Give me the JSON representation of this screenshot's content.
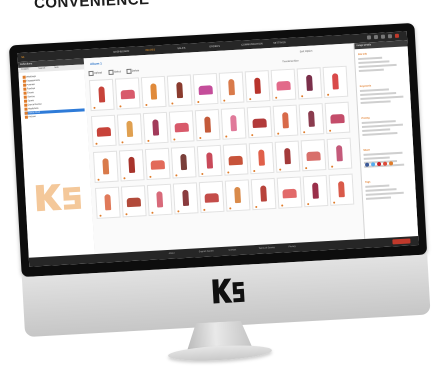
{
  "headline": "CONVENIENCE",
  "app": {
    "brand_initials": "ks",
    "top_nav": [
      {
        "label": "DASHBOARD",
        "active": false
      },
      {
        "label": "IMAGES",
        "active": true
      },
      {
        "label": "SALES",
        "active": false
      },
      {
        "label": "ORDERS",
        "active": false
      },
      {
        "label": "COMMUNICATION",
        "active": false
      },
      {
        "label": "SETTINGS",
        "active": false
      }
    ],
    "sidebar": {
      "title": "Collections",
      "tabs": [
        "Folders",
        "Search",
        "Sets"
      ],
      "items": [
        {
          "label": "Weddings",
          "selected": false
        },
        {
          "label": "Engagements",
          "selected": false
        },
        {
          "label": "Portraits",
          "selected": false
        },
        {
          "label": "Families",
          "selected": false
        },
        {
          "label": "Events",
          "selected": false
        },
        {
          "label": "Seniors",
          "selected": false
        },
        {
          "label": "Sports",
          "selected": false
        },
        {
          "label": "Dance Recital",
          "selected": false
        },
        {
          "label": "Headshots",
          "selected": false
        },
        {
          "label": "Dance 2013",
          "selected": true
        },
        {
          "label": "Archive",
          "selected": false
        }
      ]
    },
    "main": {
      "title": "Album 1",
      "sort_label": "Sort Option",
      "toolbar": [
        "Upload",
        "Select",
        "Delete"
      ],
      "paging": "Thumbnail Size",
      "thumb_colors": [
        "#c7433a",
        "#d85a6b",
        "#e08a3a",
        "#8a3b2e",
        "#c44d9a",
        "#d97a4a",
        "#b8342c",
        "#e26a8a",
        "#7a2f4a",
        "#d94a4a",
        "#c7433a",
        "#e0a050",
        "#a23a5a",
        "#d85a6b",
        "#c45a3a",
        "#e07a9a",
        "#b23a3a",
        "#d86a4a",
        "#8a3b4e",
        "#c44d6a",
        "#d97a4a",
        "#a8342c",
        "#e26a5a",
        "#7a3f3a",
        "#c94a5a",
        "#c7533a",
        "#e0604a",
        "#a33a3a",
        "#d8706b",
        "#c45a7a",
        "#e07a5a",
        "#b24a3a",
        "#d86a7a",
        "#8a3b3e",
        "#c44d4a",
        "#d98a4a",
        "#b8443c",
        "#e26a6a",
        "#9a2f4a",
        "#d95a4a"
      ]
    },
    "right_panel": {
      "title": "Image Details",
      "sections": [
        "File Info",
        "Keywords",
        "Pricing",
        "Share",
        "Tags"
      ],
      "share_colors": [
        "#3b5998",
        "#55acee",
        "#cb2027",
        "#dd4b39",
        "#e07c2a"
      ]
    },
    "footer_links": [
      "About",
      "Support Center",
      "Contact",
      "Terms of Service",
      "Privacy"
    ],
    "logo_text": "ks"
  }
}
